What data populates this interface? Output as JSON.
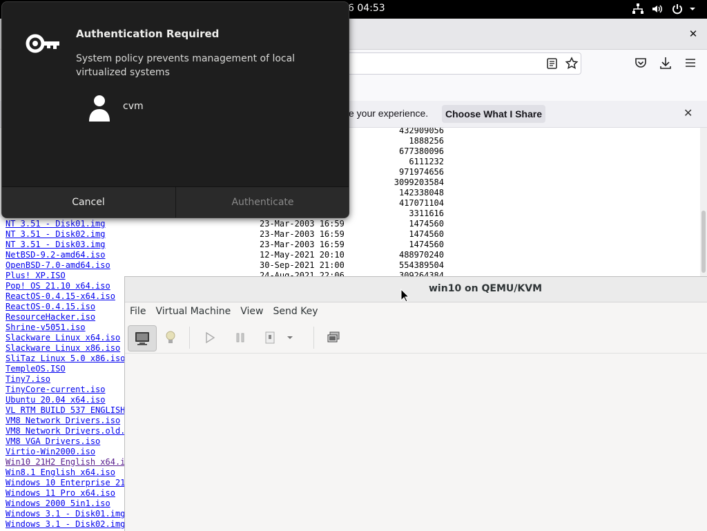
{
  "topbar": {
    "clock": "6 04:53",
    "icons": [
      "network-icon",
      "volume-icon",
      "power-icon",
      "chevron-down-icon"
    ]
  },
  "firefox": {
    "close_label": "✕",
    "notice": {
      "text": "e your experience.",
      "button": "Choose What I Share",
      "close": "✕"
    },
    "toolbar_icons": [
      "reader-view-icon",
      "bookmark-star-icon",
      "pocket-icon",
      "downloads-icon",
      "menu-icon"
    ]
  },
  "listing": {
    "top_rows": [
      {
        "size": "432909056"
      },
      {
        "size": "1888256"
      },
      {
        "size": "677380096"
      },
      {
        "size": "6111232"
      },
      {
        "size": "971974656"
      },
      {
        "size": "3099203584"
      },
      {
        "size": "142338048"
      },
      {
        "size": "417071104"
      },
      {
        "size": "3311616"
      }
    ],
    "files": [
      {
        "name": "NT 3.51 - Disk01.img",
        "date": "23-Mar-2003 16:59",
        "size": "1474560"
      },
      {
        "name": "NT 3.51 - Disk02.img",
        "date": "23-Mar-2003 16:59",
        "size": "1474560"
      },
      {
        "name": "NT 3.51 - Disk03.img",
        "date": "23-Mar-2003 16:59",
        "size": "1474560"
      },
      {
        "name": "NetBSD-9.2-amd64.iso",
        "date": "12-May-2021 20:10",
        "size": "488970240"
      },
      {
        "name": "OpenBSD-7.0-amd64.iso",
        "date": "30-Sep-2021 21:00",
        "size": "554389504"
      },
      {
        "name": "Plus! XP.ISO",
        "date": "24-Aug-2021 22:06",
        "size": "309264384"
      },
      {
        "name": "Pop! OS 21.10 x64.iso",
        "date": "",
        "size": ""
      },
      {
        "name": "ReactOS-0.4.15-x64.iso",
        "date": "",
        "size": ""
      },
      {
        "name": "ReactOS-0.4.15.iso",
        "date": "",
        "size": ""
      },
      {
        "name": "ResourceHacker.iso",
        "date": "",
        "size": ""
      },
      {
        "name": "Shrine-v5051.iso",
        "date": "",
        "size": ""
      },
      {
        "name": "Slackware Linux x64.iso",
        "date": "",
        "size": ""
      },
      {
        "name": "Slackware Linux x86.iso",
        "date": "",
        "size": ""
      },
      {
        "name": "SliTaz Linux 5.0 x86.iso",
        "date": "",
        "size": ""
      },
      {
        "name": "TempleOS.ISO",
        "date": "",
        "size": ""
      },
      {
        "name": "Tiny7.iso",
        "date": "",
        "size": ""
      },
      {
        "name": "TinyCore-current.iso",
        "date": "",
        "size": ""
      },
      {
        "name": "Ubuntu 20.04 x64.iso",
        "date": "",
        "size": ""
      },
      {
        "name": "VL RTM BUILD 537 ENGLISH",
        "date": "",
        "size": ""
      },
      {
        "name": "VM8 Network Drivers.iso",
        "date": "",
        "size": ""
      },
      {
        "name": "VM8 Network Drivers.old.",
        "date": "",
        "size": ""
      },
      {
        "name": "VM8 VGA Drivers.iso",
        "date": "",
        "size": ""
      },
      {
        "name": "Virtio-Win2000.iso",
        "date": "",
        "size": ""
      },
      {
        "name": "Win10 21H2 English x64.i",
        "date": "",
        "size": "",
        "visited": true
      },
      {
        "name": "Win8.1 English x64.iso",
        "date": "",
        "size": ""
      },
      {
        "name": "Windows 10 Enterprise 21",
        "date": "",
        "size": ""
      },
      {
        "name": "Windows 11 Pro x64.iso",
        "date": "",
        "size": ""
      },
      {
        "name": "Windows 2000 5in1.iso",
        "date": "",
        "size": ""
      },
      {
        "name": "Windows 3.1 - Disk01.img",
        "date": "",
        "size": ""
      },
      {
        "name": "Windows 3.1 - Disk02.img",
        "date": "",
        "size": ""
      }
    ]
  },
  "vm_window": {
    "title": "win10 on QEMU/KVM",
    "menu": [
      "File",
      "Virtual Machine",
      "View",
      "Send Key"
    ],
    "toolbar": [
      "console-icon",
      "details-lightbulb-icon",
      "run-icon",
      "pause-icon",
      "shutdown-icon",
      "shutdown-menu-chevron-icon",
      "snapshots-icon"
    ]
  },
  "auth_dialog": {
    "title": "Authentication Required",
    "message": "System policy prevents management of local virtualized systems",
    "user": "cvm",
    "cancel": "Cancel",
    "authenticate": "Authenticate"
  },
  "colors": {
    "link": "#0000ee",
    "visited_link": "#551a8b",
    "dialog_bg": "#1e1e1e",
    "topbar_bg": "#000000"
  }
}
